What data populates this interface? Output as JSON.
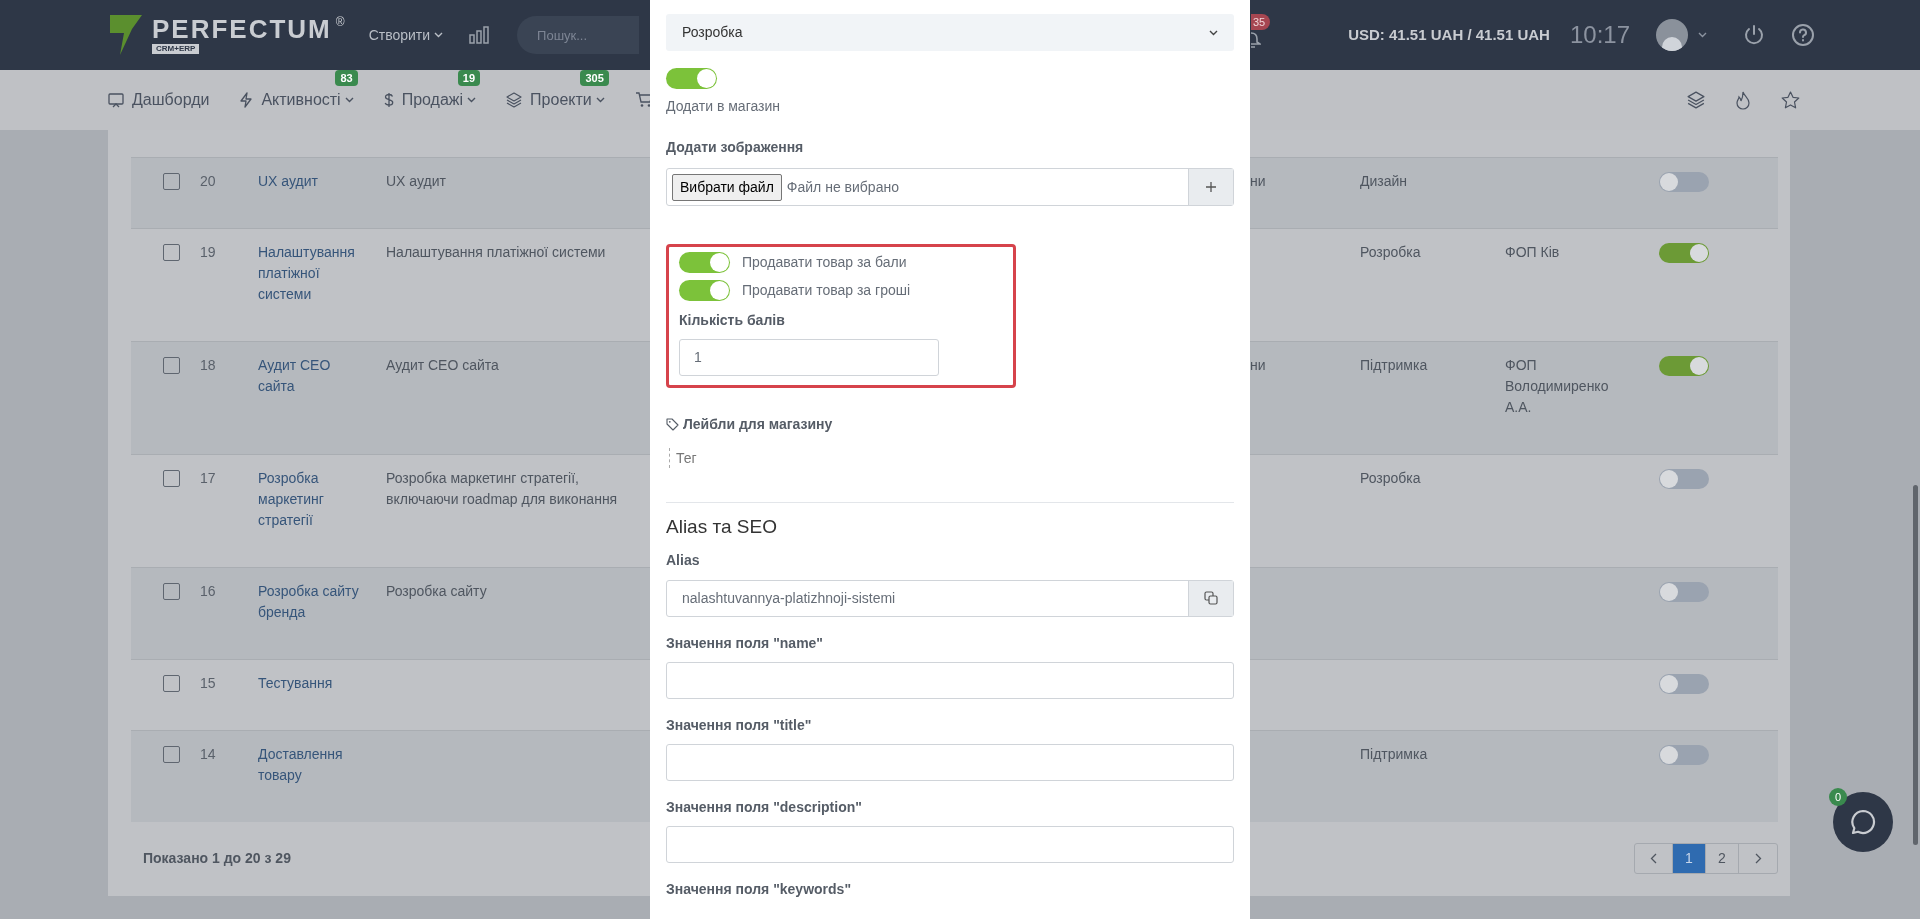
{
  "header": {
    "logo": {
      "wordmark": "PERFECTUM",
      "registered": "®",
      "tagline": "CRM+ERP"
    },
    "create_menu": "Створити",
    "search": {
      "placeholder": "Пошук..."
    },
    "notifications_badge": "35",
    "currency": "USD: 41.51 UAH / 41.51 UAH",
    "time": "10:17"
  },
  "nav": {
    "items": [
      {
        "label": "Дашборди",
        "dropdown": false
      },
      {
        "label": "Активності",
        "badge": "83",
        "dropdown": true
      },
      {
        "label": "Продажі",
        "badge": "19",
        "dropdown": true
      },
      {
        "label": "Проекти",
        "badge": "305",
        "dropdown": true
      }
    ]
  },
  "table": {
    "rows": [
      {
        "number": "20",
        "name": "UX аудит",
        "description": "UX аудит",
        "column_4": "ни",
        "category": "Дизайн",
        "checked": false,
        "enabled": false
      },
      {
        "number": "19",
        "name": "Налаштування платіжної системи",
        "description": "Налаштування платіжної системи",
        "category": "Розробка",
        "company": "ФОП Ків",
        "checked": false,
        "enabled": true
      },
      {
        "number": "18",
        "name": "Аудит СЕО сайта",
        "description": "Аудит СЕО сайта",
        "column_4": "ни",
        "category": "Підтримка",
        "company": "ФОП Володимиренко А.А.",
        "checked": false,
        "enabled": true
      },
      {
        "number": "17",
        "name": "Розробка маркетинг стратегії",
        "description": "Розробка маркетинг стратегії, включаючи roadmap для виконання",
        "category": "Розробка",
        "checked": false,
        "enabled": false
      },
      {
        "number": "16",
        "name": "Розробка сайту бренда",
        "description": "Розробка сайту",
        "checked": false,
        "enabled": false
      },
      {
        "number": "15",
        "name": "Тестування",
        "checked": false,
        "enabled": false
      },
      {
        "number": "14",
        "name": "Доставлення товару",
        "category": "Підтримка",
        "checked": false,
        "enabled": false
      }
    ]
  },
  "footer": "Показано 1 до 20 з 29",
  "pagination": {
    "pages": [
      {
        "label": "1",
        "selected": true
      },
      {
        "label": "2",
        "selected": false
      }
    ]
  },
  "modal": {
    "category_select": {
      "value": "Розробка"
    },
    "add_to_shop": {
      "label": "Додати в магазин",
      "on": true
    },
    "image": {
      "label": "Додати зображення",
      "button": "Вибрати файл",
      "status": "Файл не вибрано"
    },
    "sale_section": {
      "highlighted": true,
      "options": [
        {
          "label": "Продавати товар за бали",
          "on": true
        },
        {
          "label": "Продавати товар за гроші",
          "on": true
        }
      ],
      "points_label": "Кількість балів",
      "points_value": "1"
    },
    "shop_labels": {
      "label": "Лейбли для магазину",
      "placeholder": "Тег"
    },
    "seo": {
      "title": "Alias та SEO",
      "alias_label": "Alias",
      "alias": "nalashtuvannya-platizhnoji-sistemi",
      "fields": [
        {
          "label": "Значення поля \"name\""
        },
        {
          "label": "Значення поля \"title\""
        },
        {
          "label": "Значення поля \"description\""
        }
      ],
      "trailing_label": "Значення поля \"keywords\""
    }
  },
  "chat": {
    "badge": "0"
  }
}
